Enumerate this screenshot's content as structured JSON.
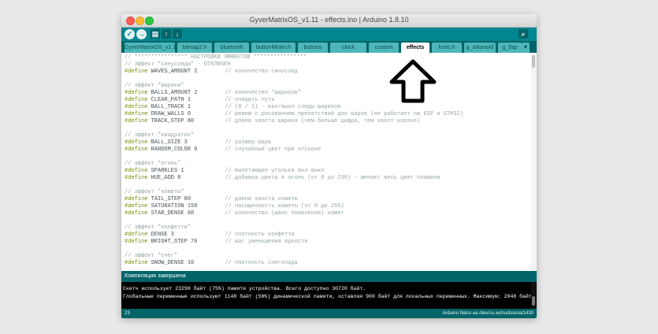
{
  "window": {
    "title": "GyverMatrixOS_v1.11 - effects.ino | Arduino 1.8.10"
  },
  "toolbar": {
    "buttons": [
      {
        "icon": "verify-icon",
        "glyph": "✓"
      },
      {
        "icon": "upload-icon",
        "glyph": "→"
      },
      {
        "icon": "new-icon",
        "glyph": "▤"
      },
      {
        "icon": "open-icon",
        "glyph": "↑"
      },
      {
        "icon": "save-icon",
        "glyph": "↓"
      }
    ],
    "serial_monitor_glyph": "⌕"
  },
  "tabs": [
    "GyverMatrixOS_v1.11",
    "bitmap2.h",
    "bluetooth",
    "buttonMinim.h",
    "buttons",
    "clock",
    "custom",
    "effects",
    "fonts.h",
    "g_arkanoid",
    "g_flap"
  ],
  "tab_menu_glyph": "▼",
  "active_tab": "effects",
  "code": [
    {
      "comment": "// **************** НАСТРОЙКИ ЭФФЕКТОВ ****************"
    },
    {
      "comment": "// эффект \"синусоиды\" - ОТКЛЮЧЕН"
    },
    {
      "keyword": "#define",
      "code": " WAVES_AMOUNT 2",
      "comment": "// количество синусоид"
    },
    {},
    {
      "comment": "// эффект \"шарики\""
    },
    {
      "keyword": "#define",
      "code": " BALLS_AMOUNT 2",
      "comment": "// количество \"шариков\""
    },
    {
      "keyword": "#define",
      "code": " CLEAR_PATH 1",
      "comment": "// очищать путь"
    },
    {
      "keyword": "#define",
      "code": " BALL_TRACK 1",
      "comment": "// (0 / 1) - вкл/выкл следы шариков"
    },
    {
      "keyword": "#define",
      "code": " DRAW_WALLS 0",
      "comment": "// режим с рисованием препятствий для шаров (не работает на ESP и STM32)"
    },
    {
      "keyword": "#define",
      "code": " TRACK_STEP 80",
      "comment": "// длина хвоста шарика (чем больше цифра, тем хвост короче)"
    },
    {},
    {
      "comment": "// эффект \"квадратик\""
    },
    {
      "keyword": "#define",
      "code": " BALL_SIZE 3",
      "comment": "// размер шара"
    },
    {
      "keyword": "#define",
      "code": " RANDOM_COLOR 0",
      "comment": "// случайный цвет при отскоке"
    },
    {},
    {
      "comment": "// эффект \"огонь\""
    },
    {
      "keyword": "#define",
      "code": " SPARKLES 1",
      "comment": "// вылетающие угольки вкл выкл"
    },
    {
      "keyword": "#define",
      "code": " HUE_ADD 0",
      "comment": "// добавка цвета в огонь (от 0 до 230) - меняет весь цвет пламени"
    },
    {},
    {
      "comment": "// эффект \"кометы\""
    },
    {
      "keyword": "#define",
      "code": " TAIL_STEP 80",
      "comment": "// длина хвоста кометы"
    },
    {
      "keyword": "#define",
      "code": " SATURATION 150",
      "comment": "// насыщенность кометы (от 0 до 255)"
    },
    {
      "keyword": "#define",
      "code": " STAR_DENSE 60",
      "comment": "// количество (шанс появления) комет"
    },
    {},
    {
      "comment": "// эффект \"конфетти\""
    },
    {
      "keyword": "#define",
      "code": " DENSE 3",
      "comment": "// плотность конфетти"
    },
    {
      "keyword": "#define",
      "code": " BRIGHT_STEP 70",
      "comment": "// шаг уменьшения яркости"
    },
    {},
    {
      "comment": "// эффект \"снег\""
    },
    {
      "keyword": "#define",
      "code": " SNOW_DENSE 10",
      "comment": "// плотность снегопада"
    }
  ],
  "status": {
    "message": "Компиляция завершена"
  },
  "console": [
    "Скетч использует 23298 байт (75%) памяти устройства. Всего доступно 30720 байт.",
    "Глобальные переменные используют 1148 байт (56%) динамической памяти, оставляя 900 байт для локальных переменных. Максимум: 2048 байт."
  ],
  "footer": {
    "line_number": "23",
    "board": "Arduino Nano на /dev/cu.wchusbserial1430"
  },
  "colors": {
    "teal_toolbar": "#00878f",
    "teal_dark": "#006468",
    "tab_inactive": "#4db7bb",
    "keyword": "#728e00",
    "comment": "#95a5a6"
  },
  "annotation": {
    "icon": "up-arrow-icon"
  }
}
